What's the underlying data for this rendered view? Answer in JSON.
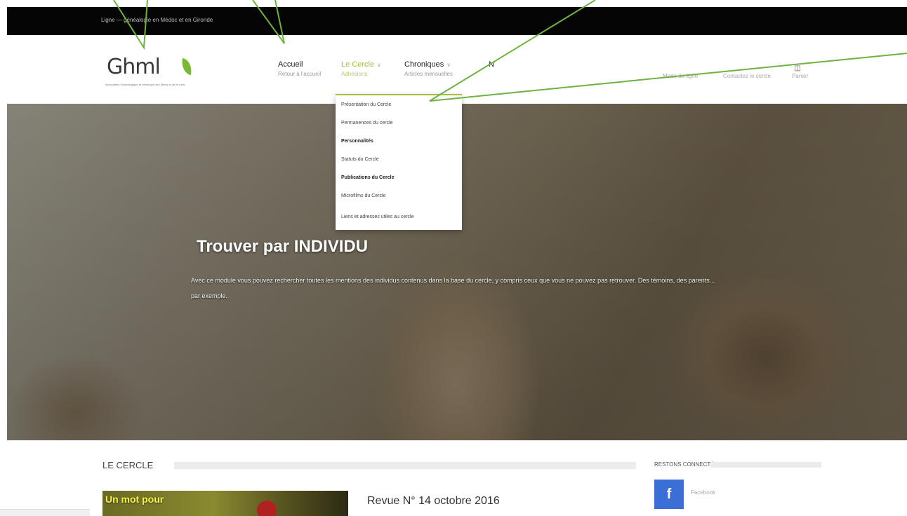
{
  "topbar": {
    "text": "Ligne — généalogie en Médoc et en Gironde"
  },
  "logo": {
    "text": "Ghml",
    "tagline": "Association Généalogique et Historique des Mines et de la Loire"
  },
  "nav": [
    {
      "label": "Accueil",
      "sub": "Retour à l'accueil"
    },
    {
      "label": "Le Cercle",
      "sub": "Adhésions",
      "caret": "∨"
    },
    {
      "label": "Chroniques",
      "sub": "Articles mensuelles",
      "caret": "∨"
    },
    {
      "label": "N",
      "sub": ""
    }
  ],
  "util": {
    "login": "Mode de ligne",
    "contact": "Contactez le cercle",
    "cart": "Panier",
    "cart_icon": "shopping-cart-icon"
  },
  "dropdown": {
    "items": [
      "Présentation du Cercle",
      "Permanences du cercle",
      "Personnalités",
      "Statuts du Cercle",
      "Publications du Cercle",
      "Microfilms du Cercle",
      "Liens et adresses utiles au cercle"
    ]
  },
  "hero": {
    "title": "Trouver par INDIVIDU",
    "description": "Avec ce module vous pouvez rechercher toutes les mentions des individus contenus dans la base du cercle, y compris ceux que vous ne pouvez pas retrouver. Des témoins, des parents... par exemple."
  },
  "section": {
    "title": "LE CERCLE"
  },
  "sidebar": {
    "title": "RESTONS CONNECTÉ",
    "facebook_icon": "f",
    "facebook_label": "Facebook"
  },
  "article": {
    "thumb_label": "Un mot pour",
    "title": "Revue N° 14 octobre 2016"
  },
  "colors": {
    "accent": "#a8bd3a",
    "facebook": "#3b6fd6",
    "callout": "#6db33f"
  }
}
